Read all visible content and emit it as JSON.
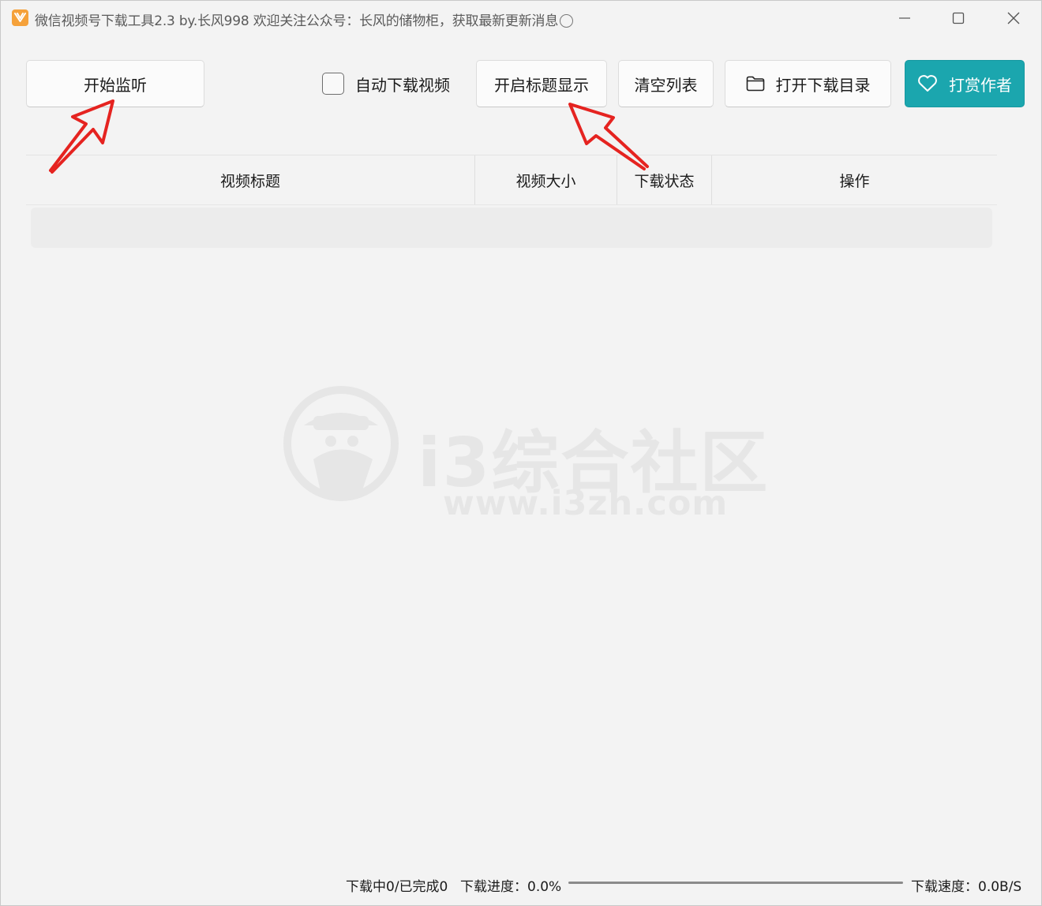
{
  "window": {
    "title": "微信视频号下载工具2.3 by.长风998  欢迎关注公众号：长风的储物柜，获取最新更新消息",
    "icon": "app-logo-icon",
    "controls": [
      "minimize-icon",
      "maximize-icon",
      "close-icon"
    ]
  },
  "toolbar": {
    "start_label": "开始监听",
    "auto_download_label": "自动下载视频",
    "auto_download_checked": false,
    "title_display_label": "开启标题显示",
    "clear_label": "清空列表",
    "open_dir_label": "打开下载目录",
    "open_dir_icon": "folder-icon",
    "tip_label": "打赏作者",
    "tip_icon": "heart-icon"
  },
  "table": {
    "columns": [
      "视频标题",
      "视频大小",
      "下载状态",
      "操作"
    ],
    "rows": []
  },
  "watermark": {
    "text": "i3综合社区",
    "url": "www.i3zh.com"
  },
  "statusbar": {
    "count_text": "下载中0/已完成0",
    "progress_label": "下载进度：0.0%",
    "progress_fraction": 0.0,
    "speed_label": "下载速度：0.0B/S"
  },
  "colors": {
    "accent": "#1ba6ae",
    "background": "#f3f3f3",
    "annotation_arrow": "#e52320"
  }
}
